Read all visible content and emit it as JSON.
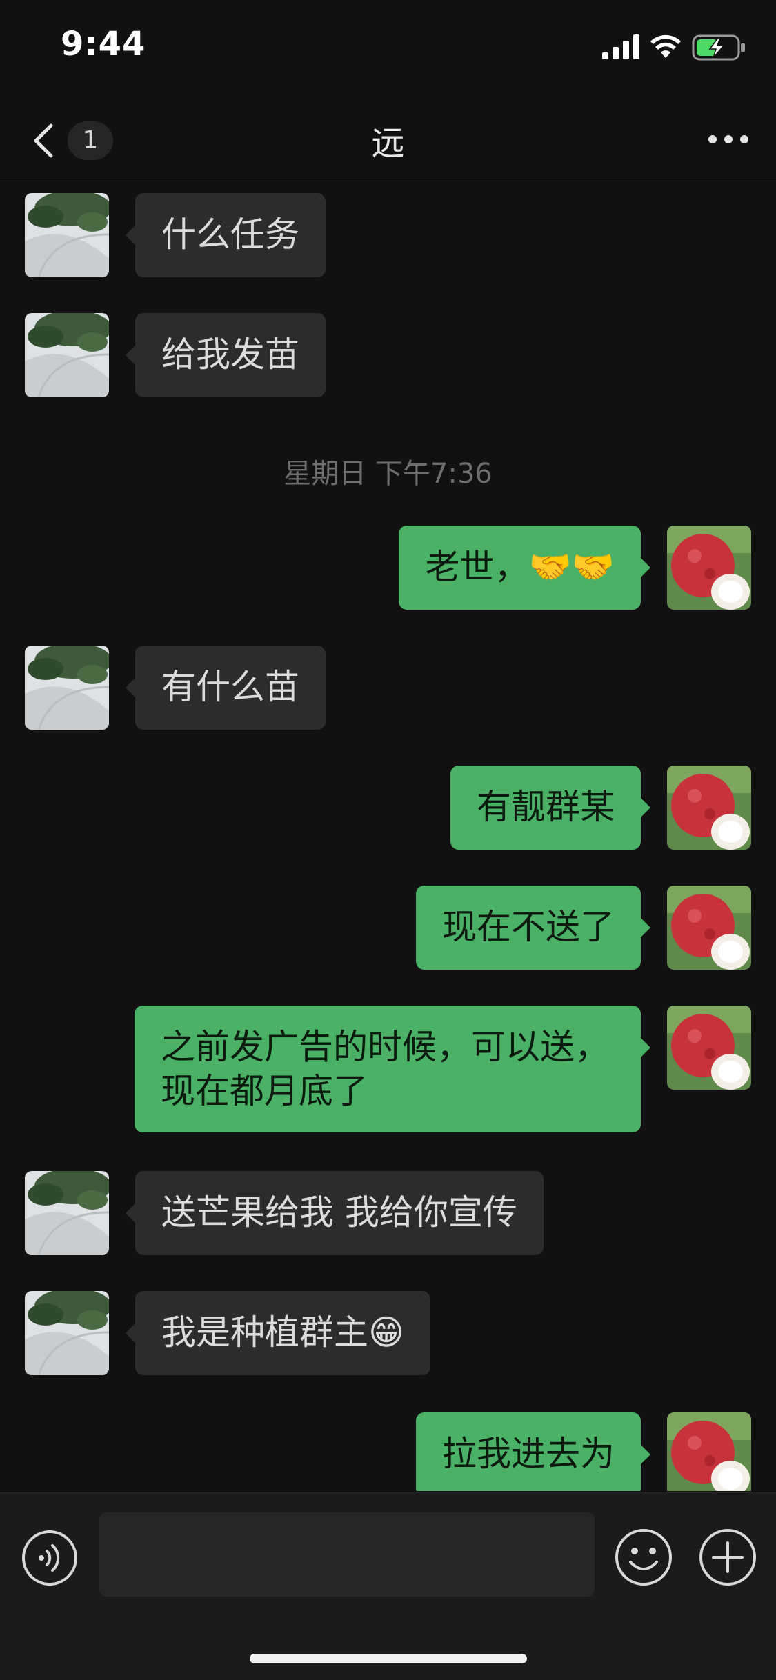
{
  "status_bar": {
    "time": "9:44"
  },
  "nav": {
    "unread_count": "1",
    "title": "远",
    "back_icon": "chevron-left-icon",
    "more_icon": "ellipsis-icon"
  },
  "messages": [
    {
      "sender": "contact",
      "text": "什么任务"
    },
    {
      "sender": "contact",
      "text": "给我发苗"
    },
    {
      "type": "timestamp",
      "text": "星期日 下午7:36"
    },
    {
      "sender": "me",
      "text": "老世，🤝🤝"
    },
    {
      "sender": "contact",
      "text": "有什么苗"
    },
    {
      "sender": "me",
      "text": "有靓群某"
    },
    {
      "sender": "me",
      "text": "现在不送了"
    },
    {
      "sender": "me",
      "text": "之前发广告的时候，可以送，\n现在都月底了"
    },
    {
      "sender": "contact",
      "text": "送芒果给我 我给你宣传"
    },
    {
      "sender": "contact",
      "text": "我是种植群主😁"
    },
    {
      "sender": "me",
      "text": "拉我进去为"
    }
  ],
  "input_bar": {
    "placeholder": "",
    "voice_icon": "voice-icon",
    "emoji_icon": "emoji-icon",
    "plus_icon": "plus-icon"
  },
  "colors": {
    "background": "#111111",
    "outgoing_bubble": "#4ab166",
    "incoming_bubble": "#2c2c2c"
  }
}
